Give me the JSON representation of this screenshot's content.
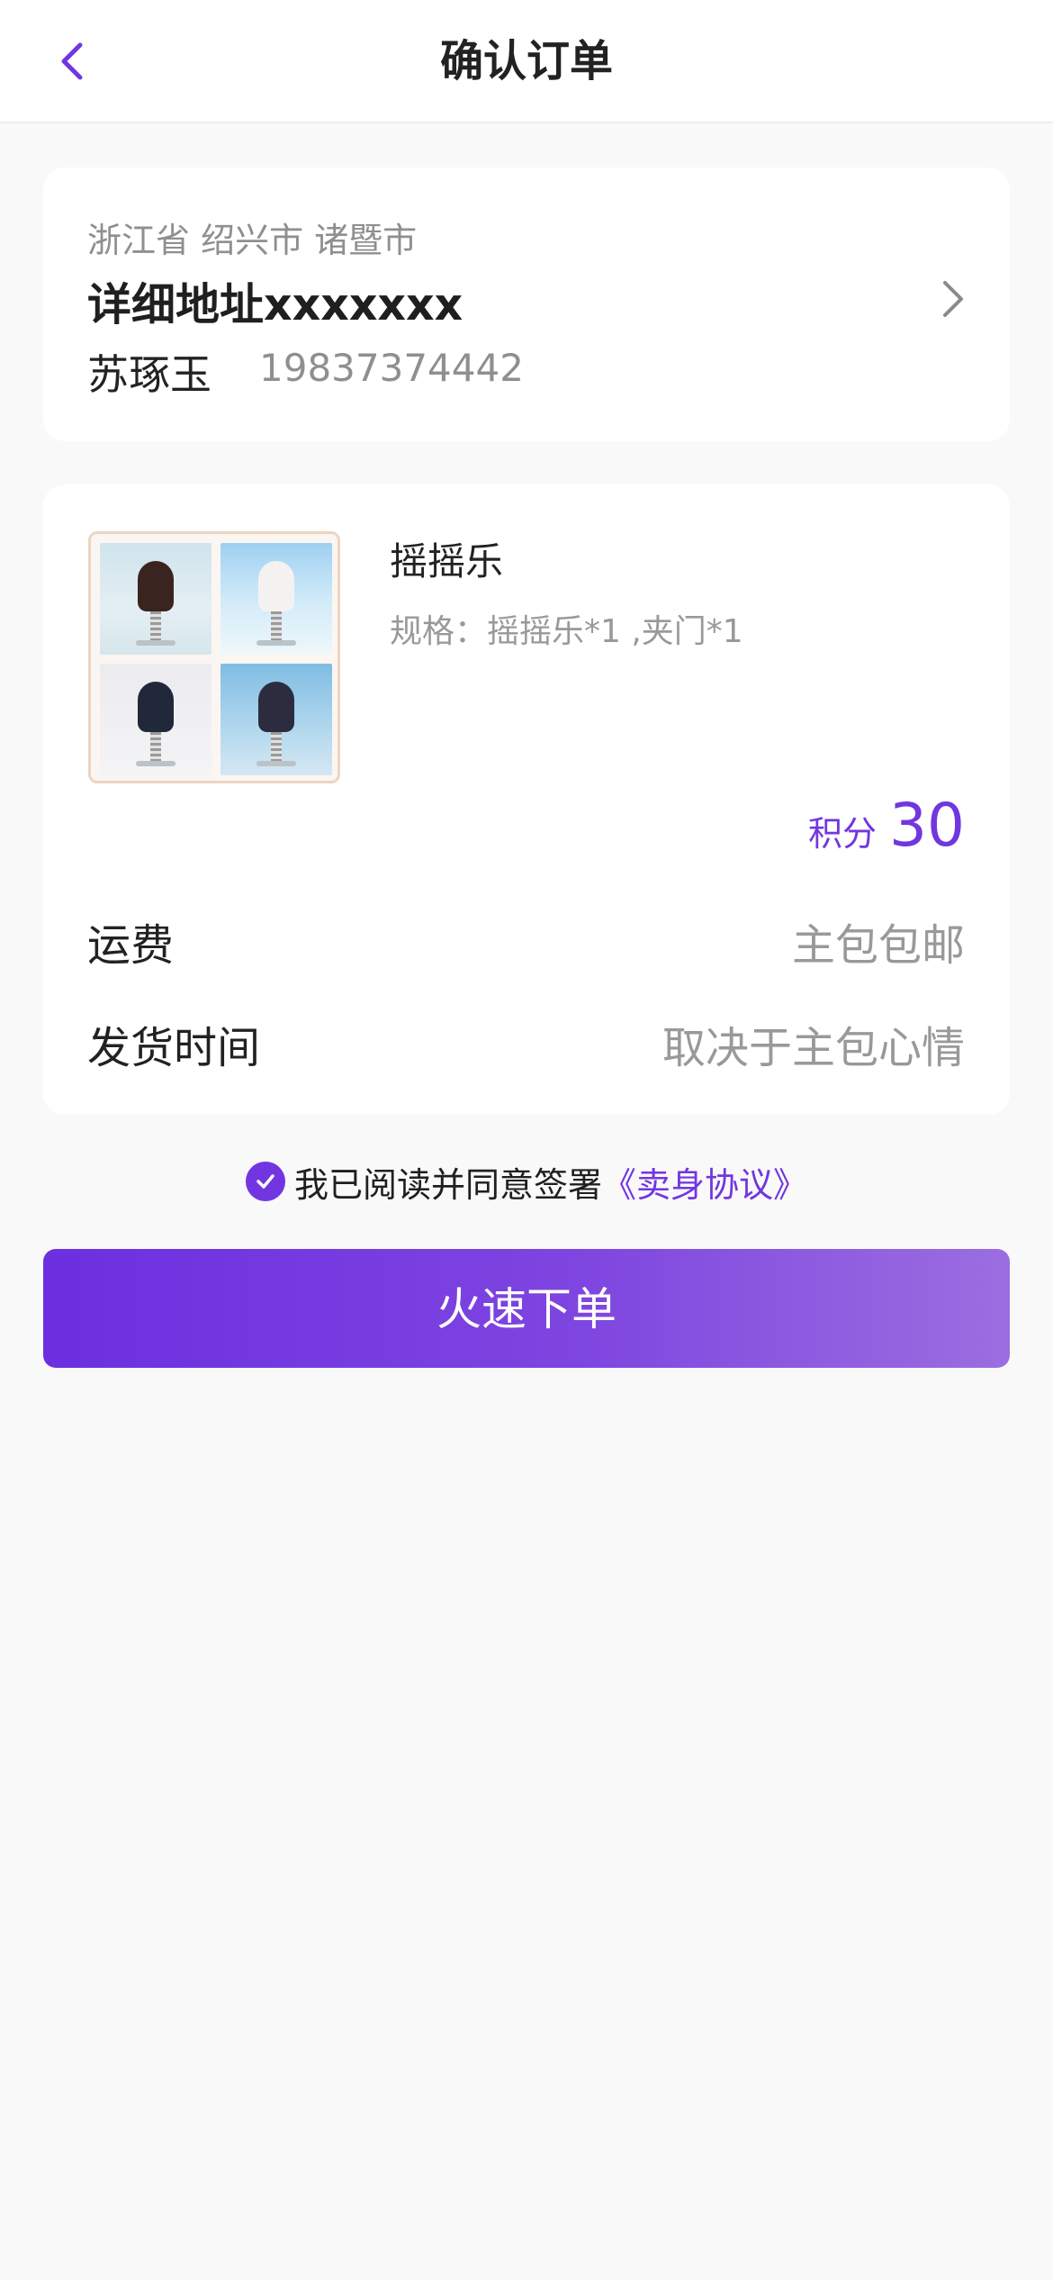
{
  "header": {
    "title": "确认订单"
  },
  "address": {
    "region": "浙江省 绍兴市 诸暨市",
    "detail": "详细地址xxxxxxx",
    "name": "苏琢玉",
    "phone": "19837374442"
  },
  "product": {
    "name": "摇摇乐",
    "spec": "规格：摇摇乐*1 ,夹门*1",
    "price_label": "积分",
    "price_value": "30"
  },
  "shipping": {
    "label": "运费",
    "value": "主包包邮"
  },
  "dispatch": {
    "label": "发货时间",
    "value": "取决于主包心情"
  },
  "agreement": {
    "checked": true,
    "text": "我已阅读并同意签署",
    "link": "《卖身协议》"
  },
  "submit": {
    "label": "火速下单"
  },
  "colors": {
    "accent": "#7236e0",
    "background": "#f9f9f9",
    "card": "#ffffff",
    "secondary_text": "#999999"
  }
}
